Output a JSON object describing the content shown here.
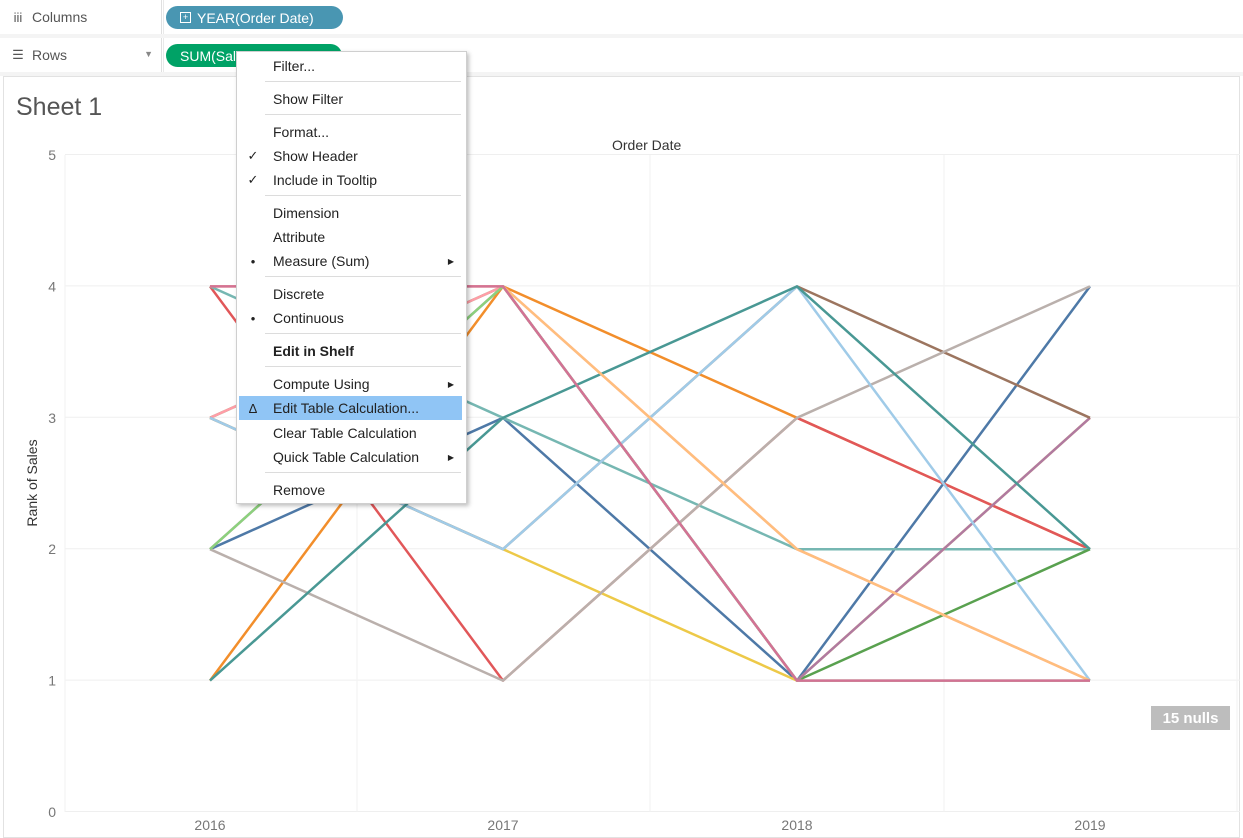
{
  "shelves": {
    "columns": {
      "label": "Columns",
      "icon": "columns-icon",
      "pill": "YEAR(Order Date)"
    },
    "rows": {
      "label": "Rows",
      "icon": "rows-icon",
      "pill": "SUM(Sales)"
    }
  },
  "sheet": {
    "title": "Sheet 1",
    "column_header": "Order Date",
    "nulls_badge": "15 nulls"
  },
  "context_menu": {
    "items": [
      {
        "label": "Filter..."
      },
      {
        "label": "Show Filter"
      },
      {
        "label": "Format..."
      },
      {
        "label": "Show Header",
        "mark": "✓"
      },
      {
        "label": "Include in Tooltip",
        "mark": "✓"
      },
      {
        "label": "Dimension"
      },
      {
        "label": "Attribute"
      },
      {
        "label": "Measure (Sum)",
        "mark": "•",
        "submenu": true
      },
      {
        "label": "Discrete"
      },
      {
        "label": "Continuous",
        "mark": "•"
      },
      {
        "label": "Edit in Shelf"
      },
      {
        "label": "Compute Using",
        "submenu": true
      },
      {
        "label": "Edit Table Calculation...",
        "mark": "Δ"
      },
      {
        "label": "Clear Table Calculation"
      },
      {
        "label": "Quick Table Calculation",
        "submenu": true
      },
      {
        "label": "Remove"
      }
    ],
    "highlighted": "Edit Table Calculation...",
    "highlight_color": "#90c5f5"
  },
  "chart_data": {
    "type": "line",
    "xlabel": "",
    "ylabel": "Rank of Sales",
    "categories": [
      "2016",
      "2017",
      "2018",
      "2019"
    ],
    "ylim": [
      0,
      5
    ],
    "yticks": [
      0,
      1,
      2,
      3,
      4,
      5
    ],
    "grid": true,
    "series": [
      {
        "color": "#4e79a7",
        "values": [
          2,
          3,
          1,
          4
        ]
      },
      {
        "color": "#f28e2b",
        "values": [
          1,
          4,
          3,
          2
        ]
      },
      {
        "color": "#e15759",
        "values": [
          4,
          1,
          3,
          2
        ]
      },
      {
        "color": "#76b7b2",
        "values": [
          4,
          3,
          2,
          2
        ]
      },
      {
        "color": "#59a14f",
        "values": [
          3,
          4,
          1,
          2
        ]
      },
      {
        "color": "#edc948",
        "values": [
          3,
          2,
          1,
          3
        ]
      },
      {
        "color": "#b07aa1",
        "values": [
          2,
          4,
          1,
          3
        ]
      },
      {
        "color": "#ff9da7",
        "values": [
          3,
          4,
          2,
          1
        ]
      },
      {
        "color": "#9c755f",
        "values": [
          3,
          2,
          4,
          3
        ]
      },
      {
        "color": "#bab0ac",
        "values": [
          2,
          1,
          3,
          4
        ]
      },
      {
        "color": "#a0cbe8",
        "values": [
          3,
          2,
          4,
          1
        ]
      },
      {
        "color": "#499894",
        "values": [
          1,
          3,
          4,
          2
        ]
      },
      {
        "color": "#ffbe7d",
        "values": [
          4,
          4,
          2,
          1
        ]
      },
      {
        "color": "#8cd17d",
        "values": [
          2,
          4,
          1,
          1
        ]
      },
      {
        "color": "#d37295",
        "values": [
          4,
          4,
          1,
          1
        ]
      }
    ]
  }
}
